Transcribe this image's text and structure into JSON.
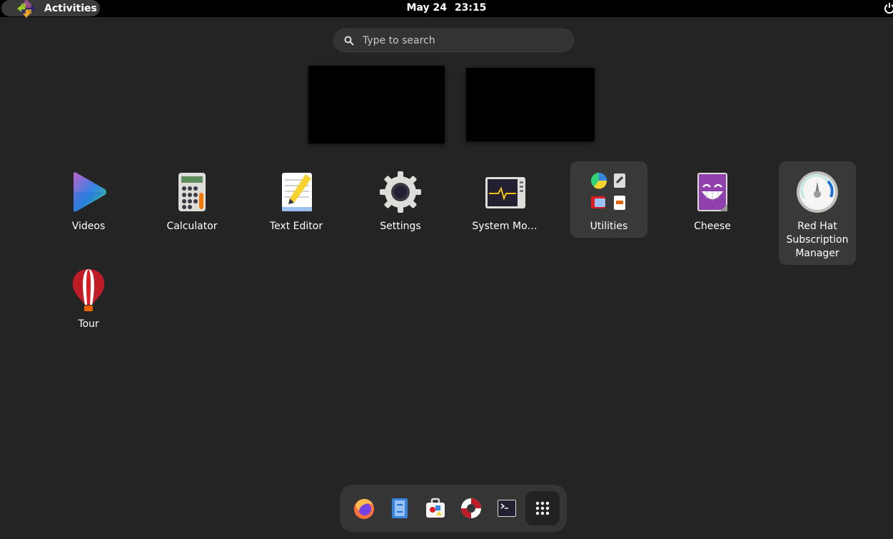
{
  "topbar": {
    "activities_label": "Activities",
    "date": "May 24",
    "time": "23:15",
    "power_icon": "power-icon"
  },
  "search": {
    "placeholder": "Type to search",
    "value": ""
  },
  "apps": [
    {
      "label": "Videos",
      "icon": "videos-icon"
    },
    {
      "label": "Calculator",
      "icon": "calculator-icon"
    },
    {
      "label": "Text Editor",
      "icon": "text-editor-icon"
    },
    {
      "label": "Settings",
      "icon": "settings-gear-icon"
    },
    {
      "label": "System Mo…",
      "icon": "system-monitor-icon"
    },
    {
      "label": "Utilities",
      "icon": "utilities-folder-icon"
    },
    {
      "label": "Cheese",
      "icon": "cheese-icon"
    },
    {
      "label": "Red Hat Subscription Manager",
      "icon": "subscription-manager-icon"
    },
    {
      "label": "Tour",
      "icon": "tour-balloon-icon"
    }
  ],
  "dock": [
    {
      "icon": "firefox-icon"
    },
    {
      "icon": "files-icon"
    },
    {
      "icon": "software-icon"
    },
    {
      "icon": "help-icon"
    },
    {
      "icon": "terminal-icon"
    },
    {
      "icon": "show-apps-grid-icon"
    }
  ],
  "colors": {
    "background": "#242424",
    "topbar": "#000000",
    "selected_tile": "#393939",
    "dock": "#353535"
  }
}
